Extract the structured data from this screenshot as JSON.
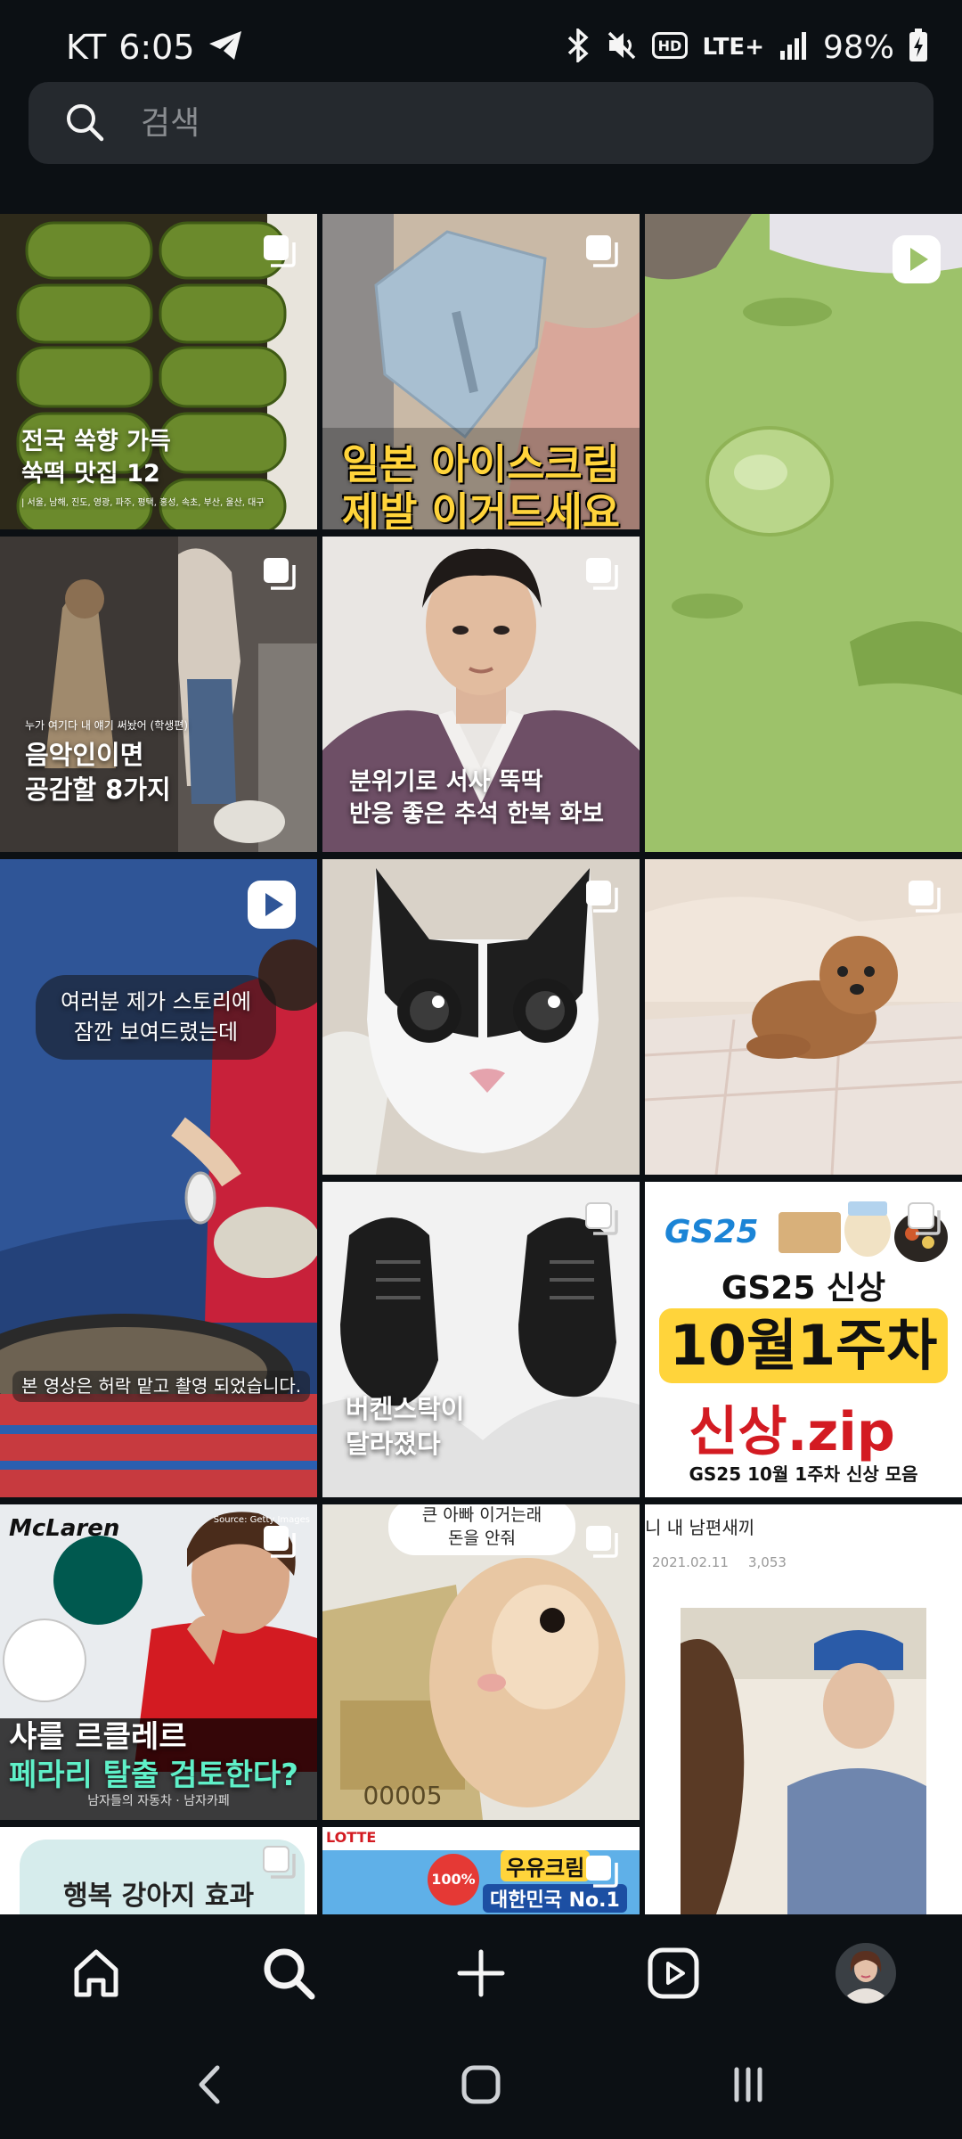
{
  "status_bar": {
    "carrier": "KT",
    "time": "6:05",
    "network": "LTE+",
    "battery": "98%"
  },
  "search": {
    "placeholder": "검색",
    "value": ""
  },
  "tiles": [
    {
      "type": "carousel",
      "caption_lines": [
        "전국 쑥향 가득",
        "쑥떡 맛집 12"
      ],
      "subcaption": "| 서울, 남해, 진도, 영광, 파주, 평택, 홍성, 속초, 부산, 울산, 대구"
    },
    {
      "type": "carousel",
      "caption_lines": [
        "일본 아이스크림",
        "제발 이거드세요"
      ]
    },
    {
      "type": "reel"
    },
    {
      "type": "carousel",
      "subcaption": "누가 여기다 내 얘기 써놨어 (학생편)",
      "caption_lines": [
        "음악인이면",
        "공감할 8가지"
      ]
    },
    {
      "type": "carousel",
      "caption_lines": [
        "분위기로 서사 뚝딱",
        "반응 좋은 추석 한복 화보"
      ]
    },
    {
      "type": "reel",
      "caption_lines": [
        "여러분 제가 스토리에",
        "잠깐 보여드렸는데"
      ],
      "subcaption": "본 영상은 허락 맡고 촬영 되었습니다."
    },
    {
      "type": "carousel"
    },
    {
      "type": "carousel"
    },
    {
      "type": "carousel",
      "caption_lines": [
        "버켄스탁이",
        "달라졌다"
      ]
    },
    {
      "type": "carousel",
      "brand": "GS25",
      "headline": "GS25 신상",
      "banner": "10월1주차",
      "big": "신상.zip",
      "footer": "GS25 10월 1주차 신상 모음"
    },
    {
      "type": "carousel",
      "brand": "McLaren",
      "caption_lines": [
        "샤를 르클레르",
        "페라리 탈출 검토한다?"
      ],
      "source": "Source: Getty Images",
      "footer": "남자들의 자동차 · 남자카페"
    },
    {
      "type": "carousel",
      "bubble_lines": [
        "큰 아빠 이거는래",
        "돈을 안줘"
      ]
    },
    {
      "type": "video",
      "title": "니 내 남편새끼",
      "date": "2021.02.11",
      "views": "3,053"
    },
    {
      "type": "carousel",
      "caption_lines": [
        "행복 강아지 효과"
      ]
    },
    {
      "type": "carousel",
      "brand": "LOTTE",
      "caption_lines": [
        "대한민국 No.1"
      ],
      "badge_text": "100%",
      "sign": "우유크림"
    }
  ],
  "nav": {
    "items": [
      {
        "name": "home-icon"
      },
      {
        "name": "search-icon"
      },
      {
        "name": "plus-icon"
      },
      {
        "name": "reels-icon"
      },
      {
        "name": "profile-avatar"
      }
    ]
  },
  "colors": {
    "background": "#0c1014",
    "search_bg": "#25292e",
    "accent_yellow": "#ffd43b",
    "gs_blue": "#1b84d6",
    "ferrari_red": "#d31b22"
  }
}
